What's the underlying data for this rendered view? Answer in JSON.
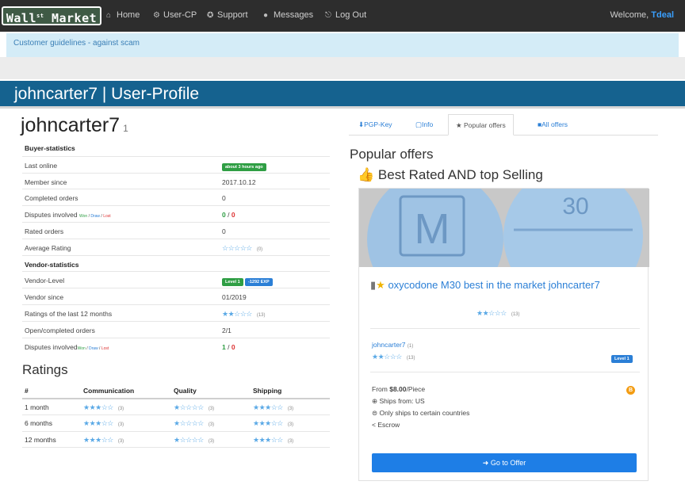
{
  "nav": {
    "logo": "Wall St Market",
    "items": [
      {
        "icon": "home-icon",
        "glyph": "⌂",
        "label": "Home"
      },
      {
        "icon": "user-cp-icon",
        "glyph": "⚙",
        "label": "User-CP"
      },
      {
        "icon": "support-icon",
        "glyph": "✪",
        "label": "Support"
      },
      {
        "icon": "messages-icon",
        "glyph": "●",
        "label": "Messages"
      },
      {
        "icon": "logout-icon",
        "glyph": "⎋",
        "label": "Log Out"
      }
    ],
    "welcome_prefix": "Welcome,",
    "welcome_user": "Tdeal"
  },
  "guideline_link": "Customer guidelines - against scam",
  "banner_title": "johncarter7 | User-Profile",
  "profile": {
    "username": "johncarter7",
    "username_count": "1",
    "buyer_section": "Buyer-statistics",
    "last_online_label": "Last online",
    "last_online_value": "about 3 hours ago",
    "member_since_label": "Member since",
    "member_since_value": "2017.10.12",
    "completed_orders_label": "Completed orders",
    "completed_orders_value": "0",
    "disputes_label": "Disputes involved",
    "disputes_win": "Won",
    "disputes_draw": "Draw",
    "disputes_lost": "Lost",
    "disputes_buyer_good": "0",
    "disputes_buyer_bad": "0",
    "rated_orders_label": "Rated orders",
    "rated_orders_value": "0",
    "average_rating_label": "Average Rating",
    "average_rating_stars": "☆☆☆☆☆",
    "average_rating_count": "(0)",
    "vendor_section": "Vendor-statistics",
    "vendor_level_label": "Vendor-Level",
    "vendor_level_badge": "Level 1",
    "vendor_exp_badge": "-1292 EXP",
    "vendor_since_label": "Vendor since",
    "vendor_since_value": "01/2019",
    "ratings_12m_label": "Ratings of the last 12 months",
    "ratings_12m_stars": "★★☆☆☆",
    "ratings_12m_count": "(13)",
    "open_completed_label": "Open/completed orders",
    "open_completed_value": "2/1",
    "vendor_disputes_label": "Disputes involved",
    "vendor_disputes_good": "1",
    "vendor_disputes_bad": "0"
  },
  "ratings": {
    "title": "Ratings",
    "headers": [
      "#",
      "Communication",
      "Quality",
      "Shipping"
    ],
    "rows": [
      {
        "period": "1 month",
        "comm": "★★★☆☆",
        "comm_n": "(3)",
        "qual": "★☆☆☆☆",
        "qual_n": "(3)",
        "ship": "★★★☆☆",
        "ship_n": "(3)"
      },
      {
        "period": "6 months",
        "comm": "★★★☆☆",
        "comm_n": "(3)",
        "qual": "★☆☆☆☆",
        "qual_n": "(3)",
        "ship": "★★★☆☆",
        "ship_n": "(3)"
      },
      {
        "period": "12 months",
        "comm": "★★★☆☆",
        "comm_n": "(3)",
        "qual": "★☆☆☆☆",
        "qual_n": "(3)",
        "ship": "★★★☆☆",
        "ship_n": "(3)"
      }
    ]
  },
  "tabs": [
    {
      "icon": "download-icon",
      "glyph": "⬇",
      "label": "PGP-Key"
    },
    {
      "icon": "info-icon",
      "glyph": "▢",
      "label": "Info"
    },
    {
      "icon": "star-icon",
      "glyph": "★",
      "label": "Popular offers"
    },
    {
      "icon": "grid-icon",
      "glyph": "■",
      "label": "All offers"
    }
  ],
  "popular": {
    "title": "Popular offers",
    "subtitle": "Best Rated AND top Selling",
    "offer_title": "oxycodone M30 best in the market johncarter7",
    "offer_stars": "★★☆☆☆",
    "offer_count": "(13)",
    "vendor_name": "johncarter7",
    "vendor_count": "(1)",
    "vendor_stars": "★★☆☆☆",
    "vendor_stars_count": "(13)",
    "level_badge": "Level 1",
    "price_prefix": "From",
    "price": "$8.00",
    "price_suffix": "/Piece",
    "ships_from": "Ships from: US",
    "ships_to": "Only ships to certain countries",
    "escrow": "Escrow",
    "coin_glyph": "B",
    "pill_left": "M",
    "pill_right": "30",
    "button": "Go to Offer"
  },
  "colors": {
    "nav_bg": "#2d2d2d",
    "banner_bg": "#15628f",
    "guide_bg": "#d4ecf7",
    "link": "#2b7fd6",
    "button": "#1e7ee6"
  }
}
